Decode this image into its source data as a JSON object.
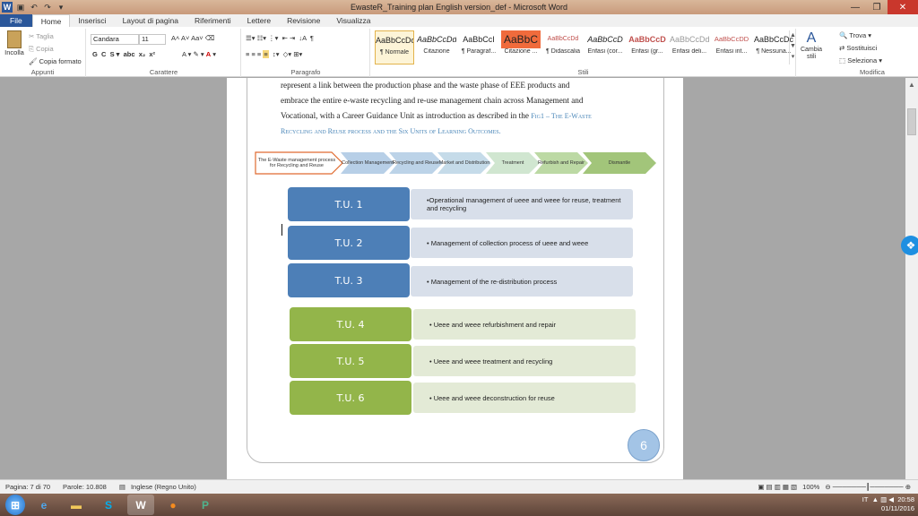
{
  "window": {
    "title": "EwasteR_Training plan English version_def - Microsoft Word"
  },
  "tabs": [
    "File",
    "Home",
    "Inserisci",
    "Layout di pagina",
    "Riferimenti",
    "Lettere",
    "Revisione",
    "Visualizza"
  ],
  "ribbon": {
    "clipboard": {
      "paste": "Incolla",
      "cut": "Taglia",
      "copy": "Copia",
      "format_painter": "Copia formato",
      "label": "Appunti"
    },
    "font": {
      "name": "Candara",
      "size": "11",
      "label": "Carattere"
    },
    "paragraph": {
      "label": "Paragrafo"
    },
    "styles": {
      "label": "Stili",
      "items": [
        {
          "preview": "AaBbCcDc",
          "name": "¶ Normale"
        },
        {
          "preview": "AaBbCcDdE",
          "name": "Citazione"
        },
        {
          "preview": "AaBbCcI",
          "name": "¶ Paragraf..."
        },
        {
          "preview": "AaBbC",
          "name": "Citazione ..."
        },
        {
          "preview": "AaBbCcDd",
          "name": "¶ Didascalia"
        },
        {
          "preview": "AaBbCcD",
          "name": "Enfasi (cor..."
        },
        {
          "preview": "AaBbCcD",
          "name": "Enfasi (gr..."
        },
        {
          "preview": "AaBbCcDdE",
          "name": "Enfasi deli..."
        },
        {
          "preview": "AaBbCcDD",
          "name": "Enfasi int..."
        },
        {
          "preview": "AaBbCcDc",
          "name": "¶ Nessuna..."
        }
      ],
      "change": "Cambia stili"
    },
    "editing": {
      "find": "Trova",
      "replace": "Sostituisci",
      "select": "Seleziona",
      "label": "Modifica"
    }
  },
  "document": {
    "paragraph_lines": [
      "represent a link between the production phase and the waste phase of EEE products and",
      "embrace the entire e-waste recycling and re-use management chain across Management and"
    ],
    "paragraph_last": "Vocational, with a Career Guidance Unit as introduction as described in the",
    "ref_line1": "Fig1 – The E-Waste",
    "ref_line2": "Recycling and Reuse process and the Six Units of Learning Outcomes.",
    "process": {
      "main": "The E-Waste management process for Recycling and Reuse",
      "steps": [
        "Collection Management",
        "Recycling and Reuse",
        "Market and Distribution",
        "Treatment",
        "Refurbish and Repair",
        "Dismantle"
      ]
    },
    "units": [
      {
        "tag": "T.U. 1",
        "desc": "•Operational management of ueee and weee for reuse, treatment and recycling"
      },
      {
        "tag": "T.U. 2",
        "desc": "• Management of collection process of ueee and weee"
      },
      {
        "tag": "T.U. 3",
        "desc": "• Management of the re-distribution process"
      },
      {
        "tag": "T.U. 4",
        "desc": "• Ueee and weee refurbishment and repair"
      },
      {
        "tag": "T.U. 5",
        "desc": "• Ueee and weee treatment and recycling"
      },
      {
        "tag": "T.U. 6",
        "desc": "• Ueee and weee deconstruction for reuse"
      }
    ],
    "page_number": "6"
  },
  "status": {
    "page": "Pagina: 7 di 70",
    "words": "Parole: 10.808",
    "language": "Inglese (Regno Unito)",
    "zoom": "100%"
  },
  "taskbar": {
    "lang": "IT",
    "time": "20:58",
    "date": "01/11/2016"
  },
  "colors": {
    "blue_tag": "#4d7fb7",
    "green_tag": "#93b54a",
    "word_blue": "#2b579a"
  }
}
